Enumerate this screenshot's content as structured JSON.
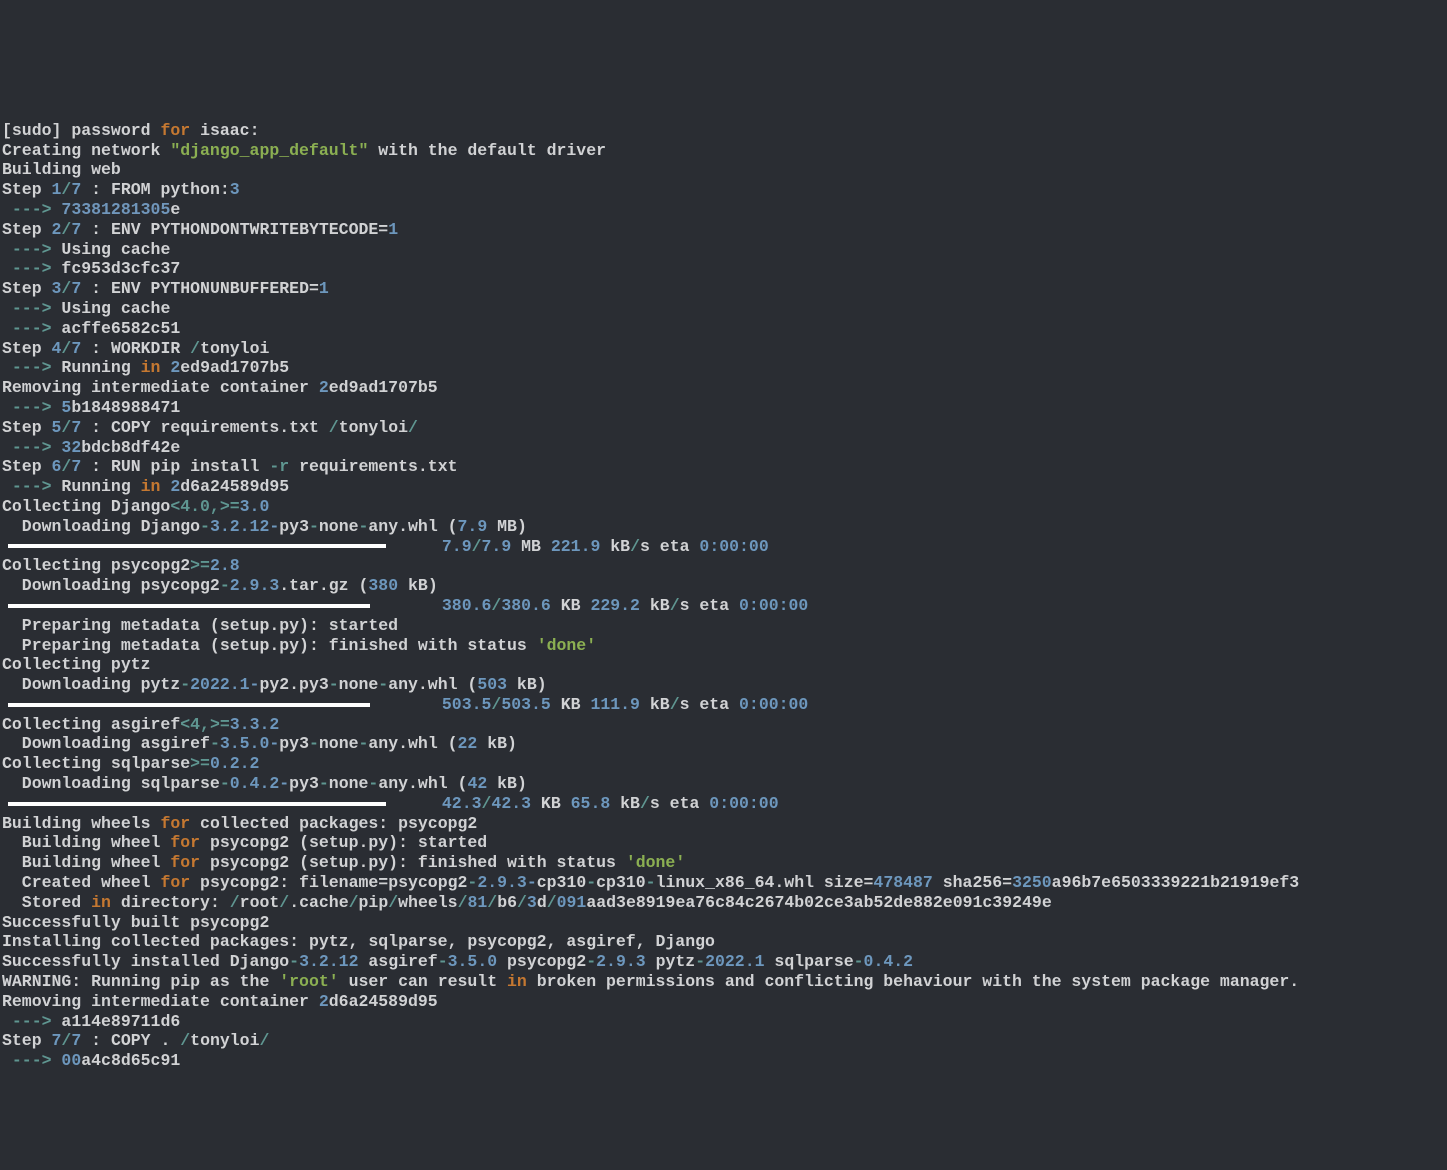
{
  "sudo_prompt": {
    "open": "[sudo]",
    "mid": " password ",
    "for": "for",
    "user": " isaac:"
  },
  "net": {
    "a": "Creating network ",
    "name": "\"django_app_default\"",
    "b": " with the default driver"
  },
  "building": "Building web",
  "steps": {
    "s1": {
      "pre": "Step ",
      "num": "1",
      "sep": "/",
      "tot": "7",
      "rest": " : FROM python:",
      "ver": "3"
    },
    "s2": {
      "pre": "Step ",
      "num": "2",
      "sep": "/",
      "tot": "7",
      "rest": " : ENV PYTHONDONTWRITEBYTECODE=",
      "val": "1"
    },
    "s3": {
      "pre": "Step ",
      "num": "3",
      "sep": "/",
      "tot": "7",
      "rest": " : ENV PYTHONUNBUFFERED=",
      "val": "1"
    },
    "s4": {
      "pre": "Step ",
      "num": "4",
      "sep": "/",
      "tot": "7",
      "rest": " : WORKDIR ",
      "path_slash": "/",
      "path": "tonyloi"
    },
    "s5": {
      "pre": "Step ",
      "num": "5",
      "sep": "/",
      "tot": "7",
      "rest": " : COPY requirements.txt ",
      "path_slash1": "/",
      "path_mid": "tonyloi",
      "path_slash2": "/"
    },
    "s6": {
      "pre": "Step ",
      "num": "6",
      "sep": "/",
      "tot": "7",
      "rest": " : RUN pip install ",
      "flag": "-r",
      "rest2": " requirements.txt"
    },
    "s7": {
      "pre": "Step ",
      "num": "7",
      "sep": "/",
      "tot": "7",
      "rest": " : COPY . ",
      "path_slash1": "/",
      "path_mid": "tonyloi",
      "path_slash2": "/"
    }
  },
  "arrows": " ---> ",
  "hashes": {
    "h1a": "73381281305",
    "h1b": "e",
    "h2": "fc953d3cfc37",
    "h3": "acffe6582c51",
    "h4a": "2",
    "h4b": "ed9ad1707b5",
    "h5a": "5",
    "h5b": "b1848988471",
    "h6a": "32",
    "h6b": "bdcb8df42e",
    "h7a": "2",
    "h7b": "d6a24589d95",
    "h8": "a114e89711d6",
    "h9a": "00",
    "h9b": "a4c8d65c91"
  },
  "cache": "Using cache",
  "running_in": "Running ",
  "in": "in",
  "rm_intermediate": "Removing intermediate container ",
  "collect": {
    "django": {
      "pre": "Collecting Django",
      "spec": "<4.0,",
      "ge": ">=",
      "ver": "3.0"
    },
    "psycopg2": {
      "pre": "Collecting psycopg2",
      "ge": ">=",
      "ver": "2.8"
    },
    "pytz": {
      "pre": "Collecting pytz"
    },
    "asgiref": {
      "pre": "Collecting asgiref",
      "spec": "<4,",
      "ge": ">=",
      "ver": "3.3.2"
    },
    "sqlparse": {
      "pre": "Collecting sqlparse",
      "ge": ">=",
      "ver": "0.2.2"
    }
  },
  "dl": {
    "django": {
      "pre": "  Downloading Django",
      "dash": "-",
      "ver": "3.2.12-",
      "mid": "py3",
      "dash2": "-",
      "mid2": "none",
      "dash3": "-",
      "tail": "any.whl (",
      "size": "7.9",
      "unit": " MB)"
    },
    "psycopg2": {
      "pre": "  Downloading psycopg2",
      "dash": "-",
      "ver": "2.9.3",
      "tail": ".tar.gz (",
      "size": "380",
      "unit": " kB)"
    },
    "pytz": {
      "pre": "  Downloading pytz",
      "dash": "-",
      "ver": "2022.1-",
      "mid": "py2.py3",
      "dash2": "-",
      "mid2": "none",
      "dash3": "-",
      "tail": "any.whl (",
      "size": "503",
      "unit": " kB)"
    },
    "asgiref": {
      "pre": "  Downloading asgiref",
      "dash": "-",
      "ver": "3.5.0-",
      "mid": "py3",
      "dash2": "-",
      "mid2": "none",
      "dash3": "-",
      "tail": "any.whl (",
      "size": "22",
      "unit": " kB)"
    },
    "sqlparse": {
      "pre": "  Downloading sqlparse",
      "dash": "-",
      "ver": "0.4.2-",
      "mid": "py3",
      "dash2": "-",
      "mid2": "none",
      "dash3": "-",
      "tail": "any.whl (",
      "size": "42",
      "unit": " kB)"
    }
  },
  "progress": {
    "django": {
      "pad": "                                             ",
      "a": "7.9",
      "slash": "/",
      "b": "7.9",
      "unit": " MB ",
      "rate": "221.9",
      "runit": " kB",
      "per": "/",
      "s": "s eta ",
      "eta": "0:00:00"
    },
    "psycopg2": {
      "pad": "                                             ",
      "a": "380.6",
      "slash": "/",
      "b": "380.6",
      "unit": " KB ",
      "rate": "229.2",
      "runit": " kB",
      "per": "/",
      "s": "s eta ",
      "eta": "0:00:00"
    },
    "pytz": {
      "pad": "                                             ",
      "a": "503.5",
      "slash": "/",
      "b": "503.5",
      "unit": " KB ",
      "rate": "111.9",
      "runit": " kB",
      "per": "/",
      "s": "s eta ",
      "eta": "0:00:00"
    },
    "sqlparse": {
      "pad": "                                             ",
      "a": "42.3",
      "slash": "/",
      "b": "42.3",
      "unit": " KB ",
      "rate": "65.8",
      "runit": " kB",
      "per": "/",
      "s": "s eta ",
      "eta": "0:00:00"
    }
  },
  "meta": {
    "start": "  Preparing metadata (setup.py): started",
    "done1": "  Preparing metadata (setup.py): finished with status ",
    "done2": "'done'"
  },
  "wheels": {
    "head1": "Building wheels ",
    "for": "for",
    "head2": " collected packages: psycopg2",
    "line1a": "  Building wheel ",
    "line1b": " psycopg2 (setup.py): started",
    "line2a": "  Building wheel ",
    "line2b": " psycopg2 (setup.py): finished with status ",
    "done": "'done'",
    "created_a": "  Created wheel ",
    "created_b": " psycopg2: filename=psycopg2",
    "dash": "-",
    "ver": "2.9.3-",
    "mid": "cp310",
    "dash2": "-",
    "mid2": "cp310",
    "dash3": "-",
    "tail": "linux_x86_64.whl size=",
    "size": "478487",
    "sha": " sha256=",
    "sha_v1": "3250",
    "sha_v2": "a96b7e6503339221b21919ef3",
    "stored_a": "  Stored ",
    "stored_b": " directory: ",
    "p0": "/",
    "p1": "root",
    "p2": "/",
    "p3": ".cache",
    "p4": "/",
    "p5": "pip",
    "p6": "/",
    "p7": "wheels",
    "p8": "/",
    "p9": "81",
    "p10": "/",
    "p11": "b6",
    "p12": "/",
    "p13": "3",
    "p14": "d",
    "p15": "/",
    "p16": "091",
    "p17": "aad3e8919ea76c84c2674b02ce3ab52de882e091c39249e"
  },
  "built": "Successfully built psycopg2",
  "installing": "Installing collected packages: pytz, sqlparse, psycopg2, asgiref, Django",
  "success": {
    "pre": "Successfully installed Django",
    "d": "-",
    "v1": "3.2.12",
    "a": " asgiref",
    "v2": "3.5.0",
    "p": " psycopg2",
    "v3": "2.9.3",
    "pt": " pytz",
    "v4": "2022.1",
    "s": " sqlparse",
    "v5": "0.4.2"
  },
  "warn": {
    "pre": "WARNING: Running pip as the ",
    "root": "'root'",
    "mid": " user can result ",
    "in": "in",
    "rest": " broken permissions and conflicting behaviour with the system package manager."
  }
}
